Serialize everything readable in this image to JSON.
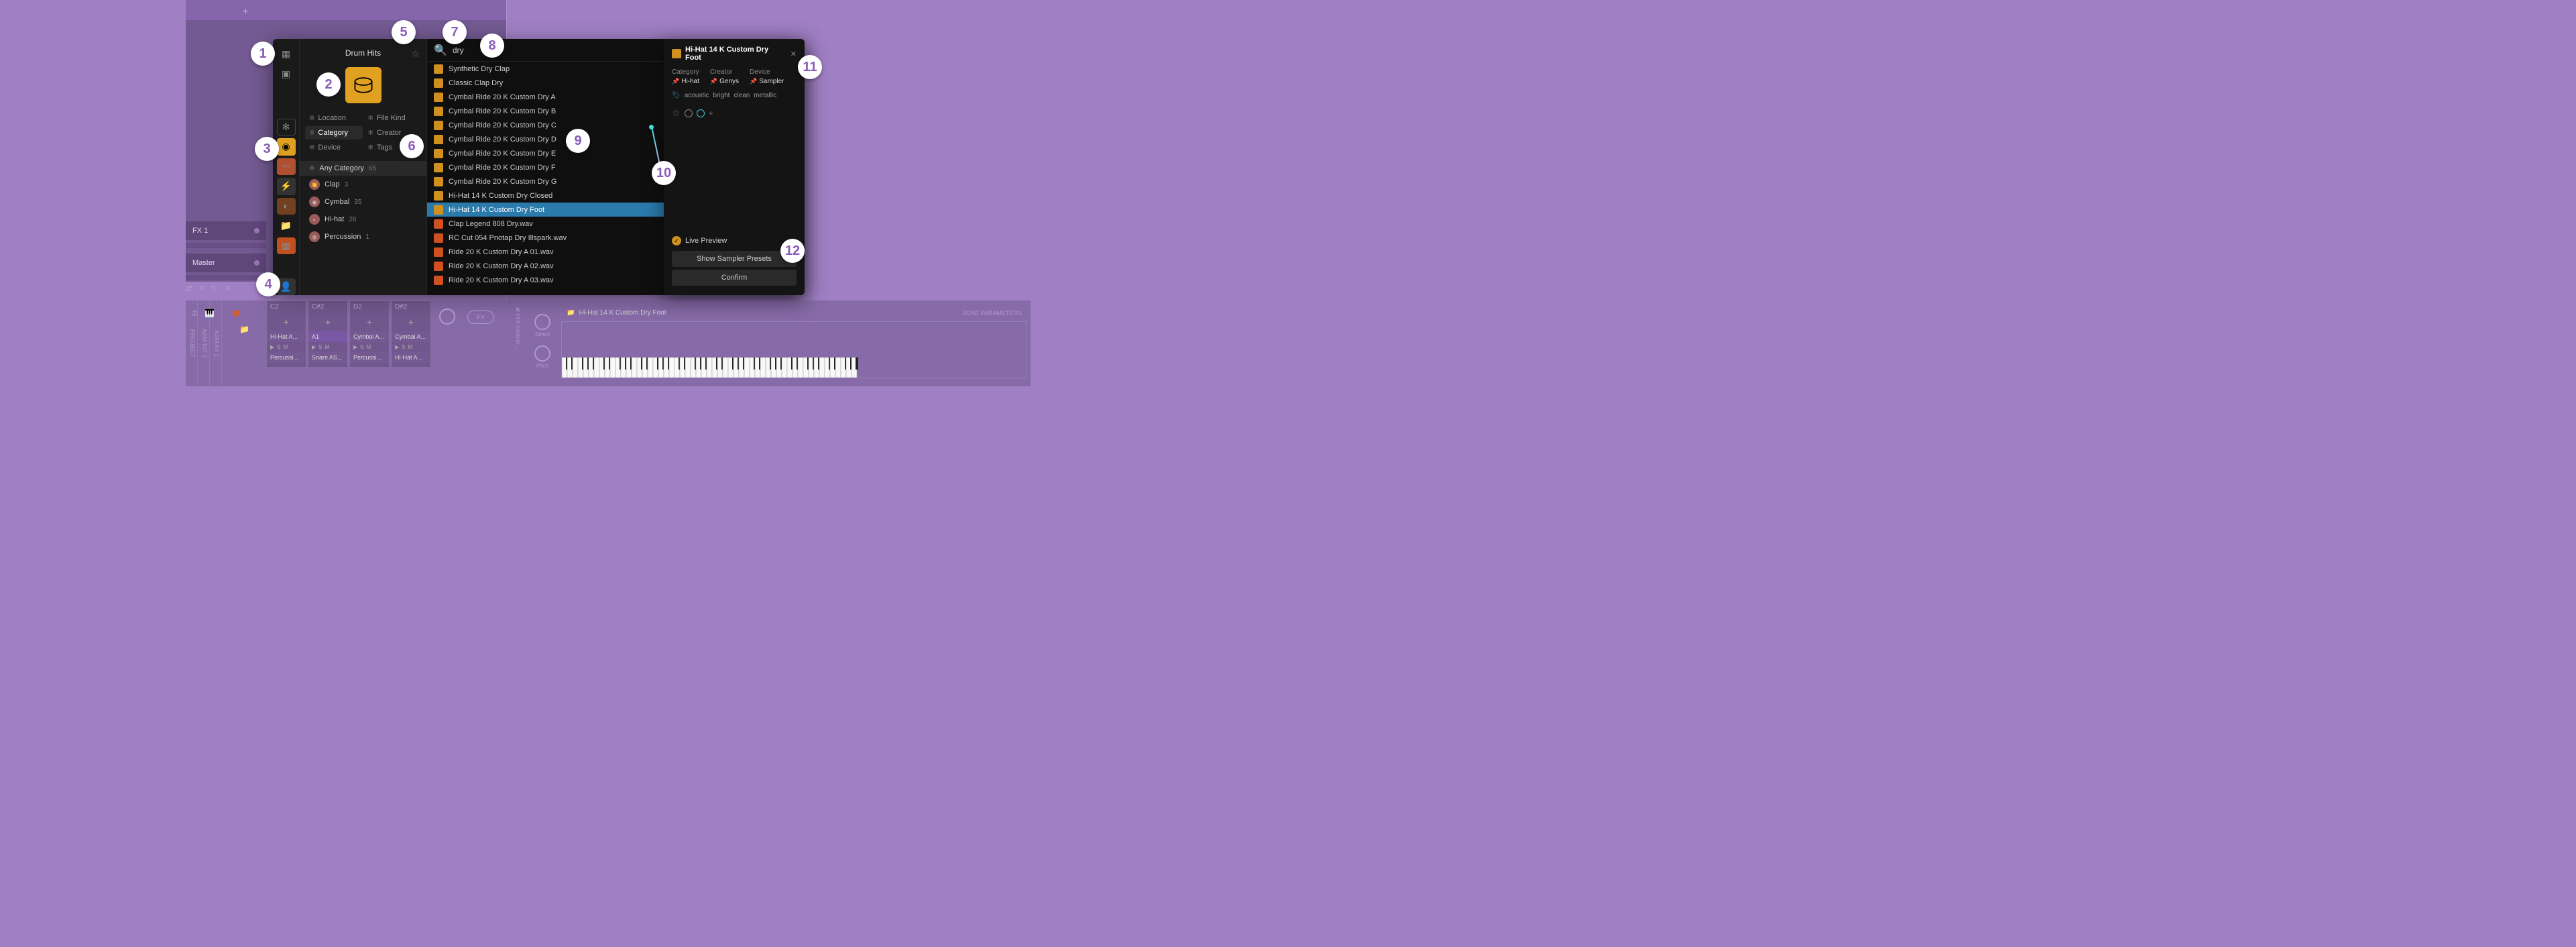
{
  "topBar": {
    "plusLabel": "+"
  },
  "tracks": [
    {
      "name": "FX 1"
    },
    {
      "name": "Master"
    }
  ],
  "bottomBar": {
    "icons": [
      "⇄",
      "≡",
      "↻",
      "✕"
    ]
  },
  "browser": {
    "title": "Drum Hits",
    "filters": [
      {
        "label": "Location"
      },
      {
        "label": "File Kind"
      },
      {
        "label": "Category",
        "selected": true
      },
      {
        "label": "Creator"
      },
      {
        "label": "Device"
      },
      {
        "label": "Tags"
      }
    ],
    "categoryHeader": {
      "label": "Any Category",
      "count": "65"
    },
    "categories": [
      {
        "label": "Clap",
        "count": "3"
      },
      {
        "label": "Cymbal",
        "count": "35"
      },
      {
        "label": "Hi-hat",
        "count": "26"
      },
      {
        "label": "Percussion",
        "count": "1"
      }
    ],
    "search": {
      "value": "dry",
      "icon": "🔍"
    },
    "results": [
      {
        "label": "Synthetic Dry Clap",
        "type": "preset"
      },
      {
        "label": "Classic Clap Dry",
        "type": "preset",
        "stars": "★•"
      },
      {
        "label": "Cymbal Ride 20 K Custom Dry A",
        "type": "preset"
      },
      {
        "label": "Cymbal Ride 20 K Custom Dry B",
        "type": "preset"
      },
      {
        "label": "Cymbal Ride 20 K Custom Dry C",
        "type": "preset"
      },
      {
        "label": "Cymbal Ride 20 K Custom Dry D",
        "type": "preset"
      },
      {
        "label": "Cymbal Ride 20 K Custom Dry E",
        "type": "preset"
      },
      {
        "label": "Cymbal Ride 20 K Custom Dry F",
        "type": "preset"
      },
      {
        "label": "Cymbal Ride 20 K Custom Dry G",
        "type": "preset"
      },
      {
        "label": "Hi-Hat 14 K Custom Dry Closed",
        "type": "preset"
      },
      {
        "label": "Hi-Hat 14 K Custom Dry Foot",
        "type": "preset",
        "selected": true
      },
      {
        "label": "Clap Legend 808 Dry.wav",
        "type": "wave",
        "star": "★"
      },
      {
        "label": "RC Cut 054 Pnotap Dry Illspark.wav",
        "type": "wave"
      },
      {
        "label": "Ride 20 K Custom Dry A 01.wav",
        "type": "wave",
        "dot": true
      },
      {
        "label": "Ride 20 K Custom Dry A 02.wav",
        "type": "wave"
      },
      {
        "label": "Ride 20 K Custom Dry A 03.wav",
        "type": "wave"
      }
    ]
  },
  "info": {
    "title": "Hi-Hat 14 K Custom Dry Foot",
    "meta": [
      {
        "label": "Category",
        "value": "Hi-hat"
      },
      {
        "label": "Creator",
        "value": "Genys"
      },
      {
        "label": "Device",
        "value": "Sampler"
      }
    ],
    "tags": [
      "acoustic",
      "bright",
      "clean",
      "metallic"
    ],
    "livePreview": "Live Preview",
    "btn1": "Show Sampler Presets",
    "btn2": "Confirm"
  },
  "sampler": {
    "verticalLabels": [
      "PROJECT",
      "ASM KIT 1",
      "ASM Kit 1"
    ],
    "zoneTitle": "Hi-Hat 14 K Custom Dry Foot",
    "zoneParams": "ZONE PARAMETERS",
    "keyLabels": [
      "C2",
      "C#2",
      "D2",
      "D#2"
    ],
    "fx": "FX",
    "knob1": "Select",
    "knob2": "Pitch",
    "padNames": [
      "Hi-Hat A...",
      "A1",
      "Cymbal A...",
      "Cymbal A..."
    ],
    "padSub": [
      "Percussi...",
      "Snare AS...",
      "Percussi...",
      "Hi-Hat A..."
    ],
    "vertSample": "at 14 K Custom ..."
  },
  "callouts": [
    "1",
    "2",
    "3",
    "4",
    "5",
    "6",
    "7",
    "8",
    "9",
    "10",
    "11",
    "12"
  ]
}
